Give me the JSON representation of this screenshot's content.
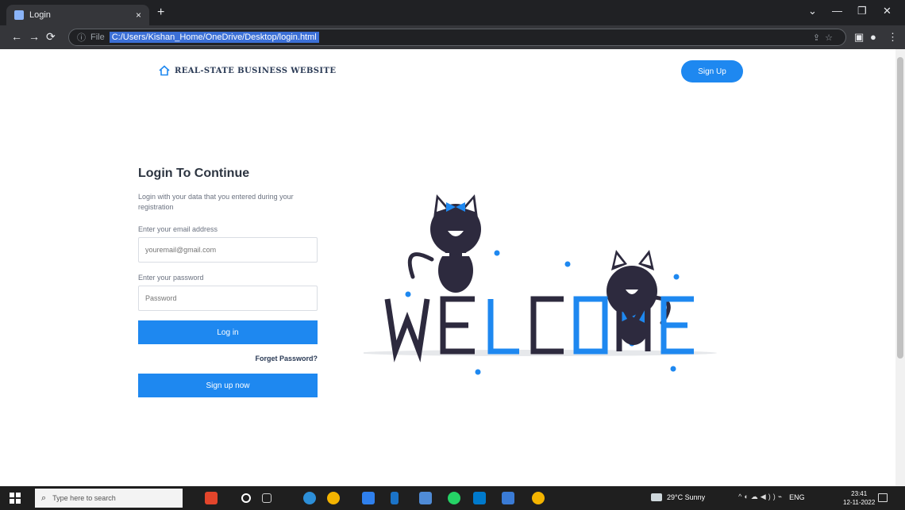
{
  "browser": {
    "tab_title": "Login",
    "tab_close": "×",
    "new_tab": "+",
    "url_scheme": "File",
    "url": "C:/Users/Kishan_Home/OneDrive/Desktop/login.html",
    "window_controls": [
      "⌄",
      "—",
      "❐",
      "✕"
    ],
    "nav_icons": [
      "←",
      "→",
      "⟳"
    ]
  },
  "header": {
    "brand": "REAL-STATE BUSINESS WEBSITE",
    "signup_label": "Sign Up"
  },
  "form": {
    "title": "Login To Continue",
    "description": "Login with your data that you entered during your registration",
    "email_label": "Enter your email address",
    "email_placeholder": "youremail@gmail.com",
    "password_label": "Enter your password",
    "password_placeholder": "Password",
    "login_label": "Log in",
    "forgot_label": "Forget Password?",
    "signup_now_label": "Sign up now"
  },
  "illustration": {
    "word": "WELCOME",
    "letter_colors": [
      "#2d2a3e",
      "#2d2a3e",
      "#1e88f0",
      "#2d2a3e",
      "#1e88f0",
      "#2d2a3e",
      "#1e88f0"
    ]
  },
  "taskbar": {
    "search_placeholder": "Type here to search",
    "weather": "29°C Sunny",
    "language": "ENG",
    "time": "23:41",
    "date": "12-11-2022"
  },
  "colors": {
    "accent": "#1e88f0",
    "text_dark": "#2c3440"
  }
}
